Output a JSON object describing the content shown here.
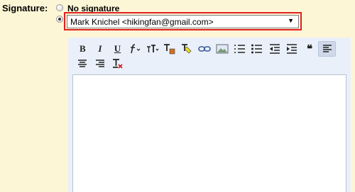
{
  "signature": {
    "label": "Signature:",
    "no_signature_label": "No signature",
    "selected_identity": "Mark Knichel <hikingfan@gmail.com>",
    "dropdown_arrow": "▼"
  },
  "toolbar": {
    "bold_label": "B",
    "italic_label": "I",
    "underline_label": "U",
    "quote_label": "❝",
    "highlight_color": "#e02020",
    "panel_color": "#eaf0f9"
  },
  "compose_body": ""
}
